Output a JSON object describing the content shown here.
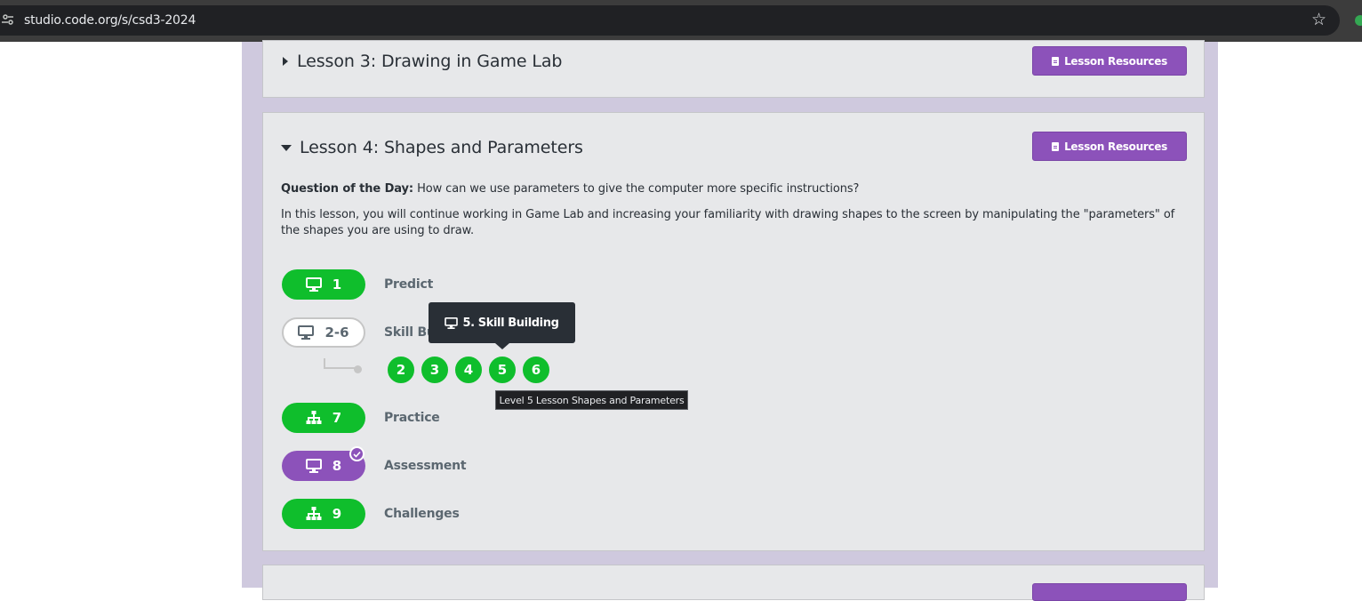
{
  "browser": {
    "url": "studio.code.org/s/csd3-2024",
    "site_info_icon": "tune-icon",
    "bookmark_icon": "star-icon"
  },
  "lesson3": {
    "title": "Lesson 3: Drawing in Game Lab",
    "resources_label": "Lesson Resources",
    "expanded": false
  },
  "lesson4": {
    "title": "Lesson 4: Shapes and Parameters",
    "resources_label": "Lesson Resources",
    "expanded": true,
    "question_label": "Question of the Day:",
    "question_text": "How can we use parameters to give the computer more specific instructions?",
    "description": "In this lesson, you will continue working in Game Lab and increasing your familiarity with drawing shapes to the screen by manipulating the \"parameters\" of the shapes you are using to draw.",
    "steps": [
      {
        "number": "1",
        "label": "Predict",
        "icon": "desktop-icon",
        "status": "completed"
      },
      {
        "number": "2-6",
        "label": "Skill Building",
        "icon": "desktop-icon",
        "status": "in-progress"
      },
      {
        "number": "7",
        "label": "Practice",
        "icon": "sitemap-icon",
        "status": "completed"
      },
      {
        "number": "8",
        "label": "Assessment",
        "icon": "desktop-icon",
        "status": "assessment-submitted"
      },
      {
        "number": "9",
        "label": "Challenges",
        "icon": "sitemap-icon",
        "status": "completed"
      }
    ],
    "sublevels": [
      "2",
      "3",
      "4",
      "5",
      "6"
    ],
    "tooltip": {
      "title": "5. Skill Building",
      "icon": "desktop-icon"
    },
    "hover_tip": "Level 5 Lesson Shapes and Parameters"
  },
  "colors": {
    "completed": "#0fbe2c",
    "assessment": "#8c52ba",
    "resources_button": "#8c52ba",
    "column_bg": "#cfc9de",
    "card_bg": "#e7e8ea"
  }
}
